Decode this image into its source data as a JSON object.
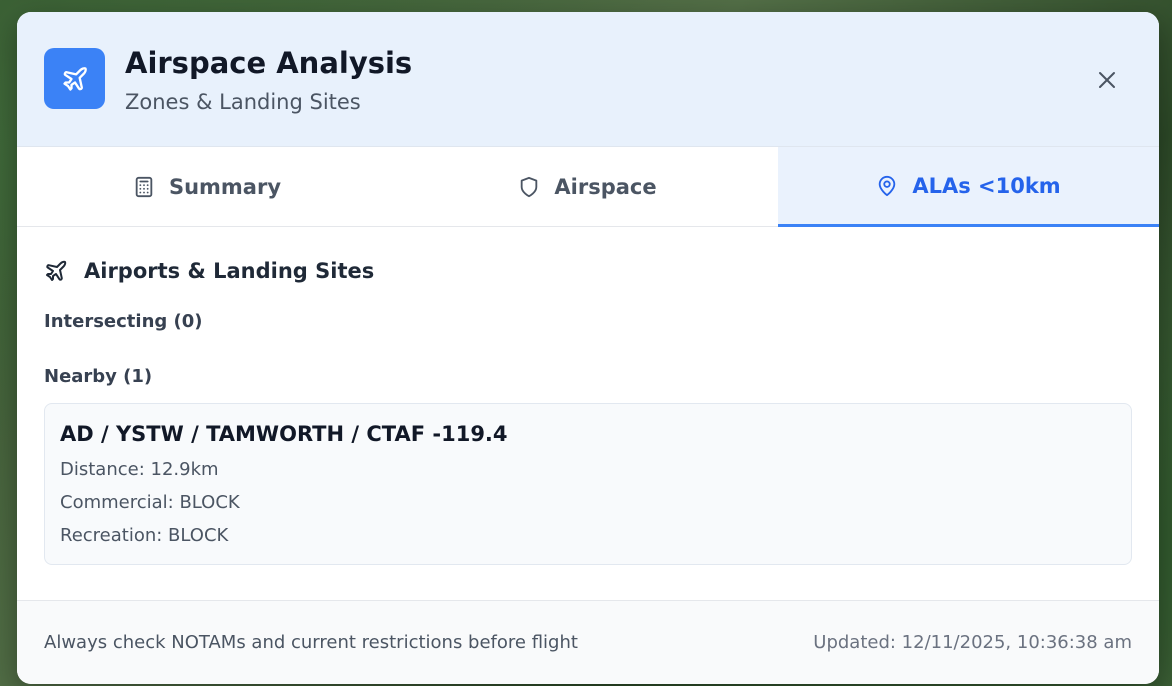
{
  "header": {
    "title": "Airspace Analysis",
    "subtitle": "Zones & Landing Sites",
    "icon": "plane-icon",
    "close_icon": "close-icon"
  },
  "tabs": [
    {
      "label": "Summary",
      "icon": "calculator-icon",
      "active": false
    },
    {
      "label": "Airspace",
      "icon": "shield-icon",
      "active": false
    },
    {
      "label": "ALAs <10km",
      "icon": "map-pin-icon",
      "active": true
    }
  ],
  "section": {
    "title": "Airports & Landing Sites",
    "icon": "plane-icon"
  },
  "groups": {
    "intersecting_label": "Intersecting (0)",
    "nearby_label": "Nearby (1)"
  },
  "nearby_card": {
    "title": "AD / YSTW / TAMWORTH / CTAF -119.4",
    "distance": "Distance: 12.9km",
    "commercial": "Commercial: BLOCK",
    "recreation": "Recreation: BLOCK"
  },
  "footer": {
    "notice": "Always check NOTAMs and current restrictions before flight",
    "updated": "Updated: 12/11/2025, 10:36:38 am"
  },
  "colors": {
    "accent": "#3b82f6",
    "active_tab_text": "#2563eb",
    "header_bg": "#e8f1fc"
  }
}
